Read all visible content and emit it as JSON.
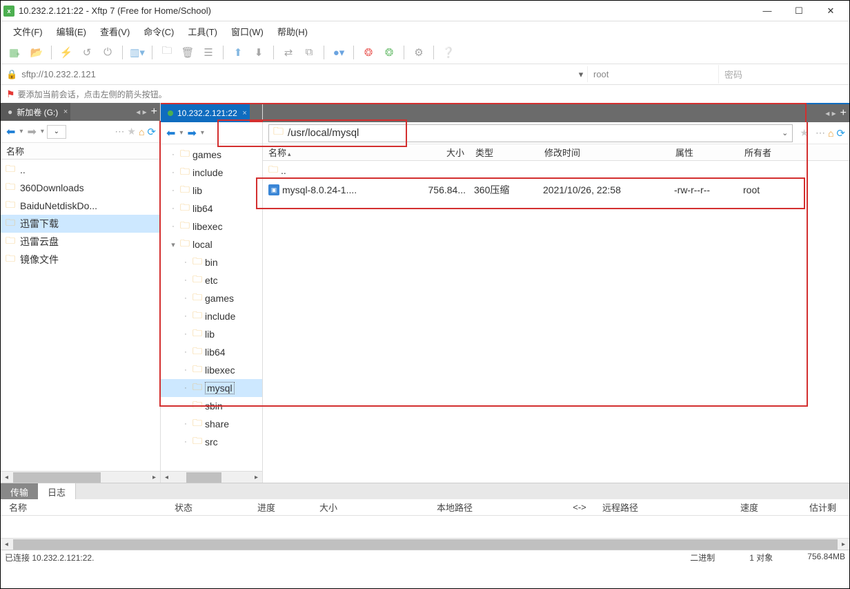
{
  "window": {
    "title": "10.232.2.121:22 - Xftp 7 (Free for Home/School)"
  },
  "menu": {
    "file": "文件(F)",
    "edit": "编辑(E)",
    "view": "查看(V)",
    "command": "命令(C)",
    "tools": "工具(T)",
    "window": "窗口(W)",
    "help": "帮助(H)"
  },
  "conn": {
    "url": "sftp://10.232.2.121",
    "user": "root",
    "password_placeholder": "密码"
  },
  "tip": "要添加当前会话，点击左侧的箭头按钮。",
  "left_tab": "新加卷 (G:)",
  "right_tab": "10.232.2.121:22",
  "left_header": "名称",
  "left_files": [
    "..",
    "360Downloads",
    "BaiduNetdiskDo...",
    "迅雷下载",
    "迅雷云盘",
    "镜像文件"
  ],
  "tree": [
    {
      "d": 0,
      "t": "",
      "n": "games"
    },
    {
      "d": 0,
      "t": "",
      "n": "include"
    },
    {
      "d": 0,
      "t": "",
      "n": "lib"
    },
    {
      "d": 0,
      "t": "",
      "n": "lib64"
    },
    {
      "d": 0,
      "t": "",
      "n": "libexec"
    },
    {
      "d": 0,
      "t": "▾",
      "n": "local"
    },
    {
      "d": 1,
      "t": "",
      "n": "bin"
    },
    {
      "d": 1,
      "t": "",
      "n": "etc"
    },
    {
      "d": 1,
      "t": "",
      "n": "games"
    },
    {
      "d": 1,
      "t": "",
      "n": "include"
    },
    {
      "d": 1,
      "t": "",
      "n": "lib"
    },
    {
      "d": 1,
      "t": "",
      "n": "lib64"
    },
    {
      "d": 1,
      "t": "",
      "n": "libexec"
    },
    {
      "d": 1,
      "t": "",
      "n": "mysql",
      "sel": true
    },
    {
      "d": 1,
      "t": "",
      "n": "sbin"
    },
    {
      "d": 1,
      "t": "",
      "n": "share"
    },
    {
      "d": 1,
      "t": "",
      "n": "src"
    }
  ],
  "right_path": "/usr/local/mysql",
  "right_cols": {
    "name": "名称",
    "size": "大小",
    "type": "类型",
    "mtime": "修改时间",
    "attr": "属性",
    "owner": "所有者"
  },
  "right_rows": [
    {
      "name": "..",
      "icon": "folder"
    },
    {
      "name": "mysql-8.0.24-1....",
      "size": "756.84...",
      "type": "360压缩",
      "mtime": "2021/10/26, 22:58",
      "attr": "-rw-r--r--",
      "owner": "root",
      "icon": "file"
    }
  ],
  "bottom_tabs": {
    "transfer": "传输",
    "log": "日志"
  },
  "transfer_cols": {
    "name": "名称",
    "status": "状态",
    "progress": "进度",
    "size": "大小",
    "local": "本地路径",
    "dir": "<->",
    "remote": "远程路径",
    "speed": "速度",
    "eta": "估计剩"
  },
  "status": {
    "conn": "已连接 10.232.2.121:22.",
    "mode": "二进制",
    "objects": "1 对象",
    "total": "756.84MB"
  }
}
